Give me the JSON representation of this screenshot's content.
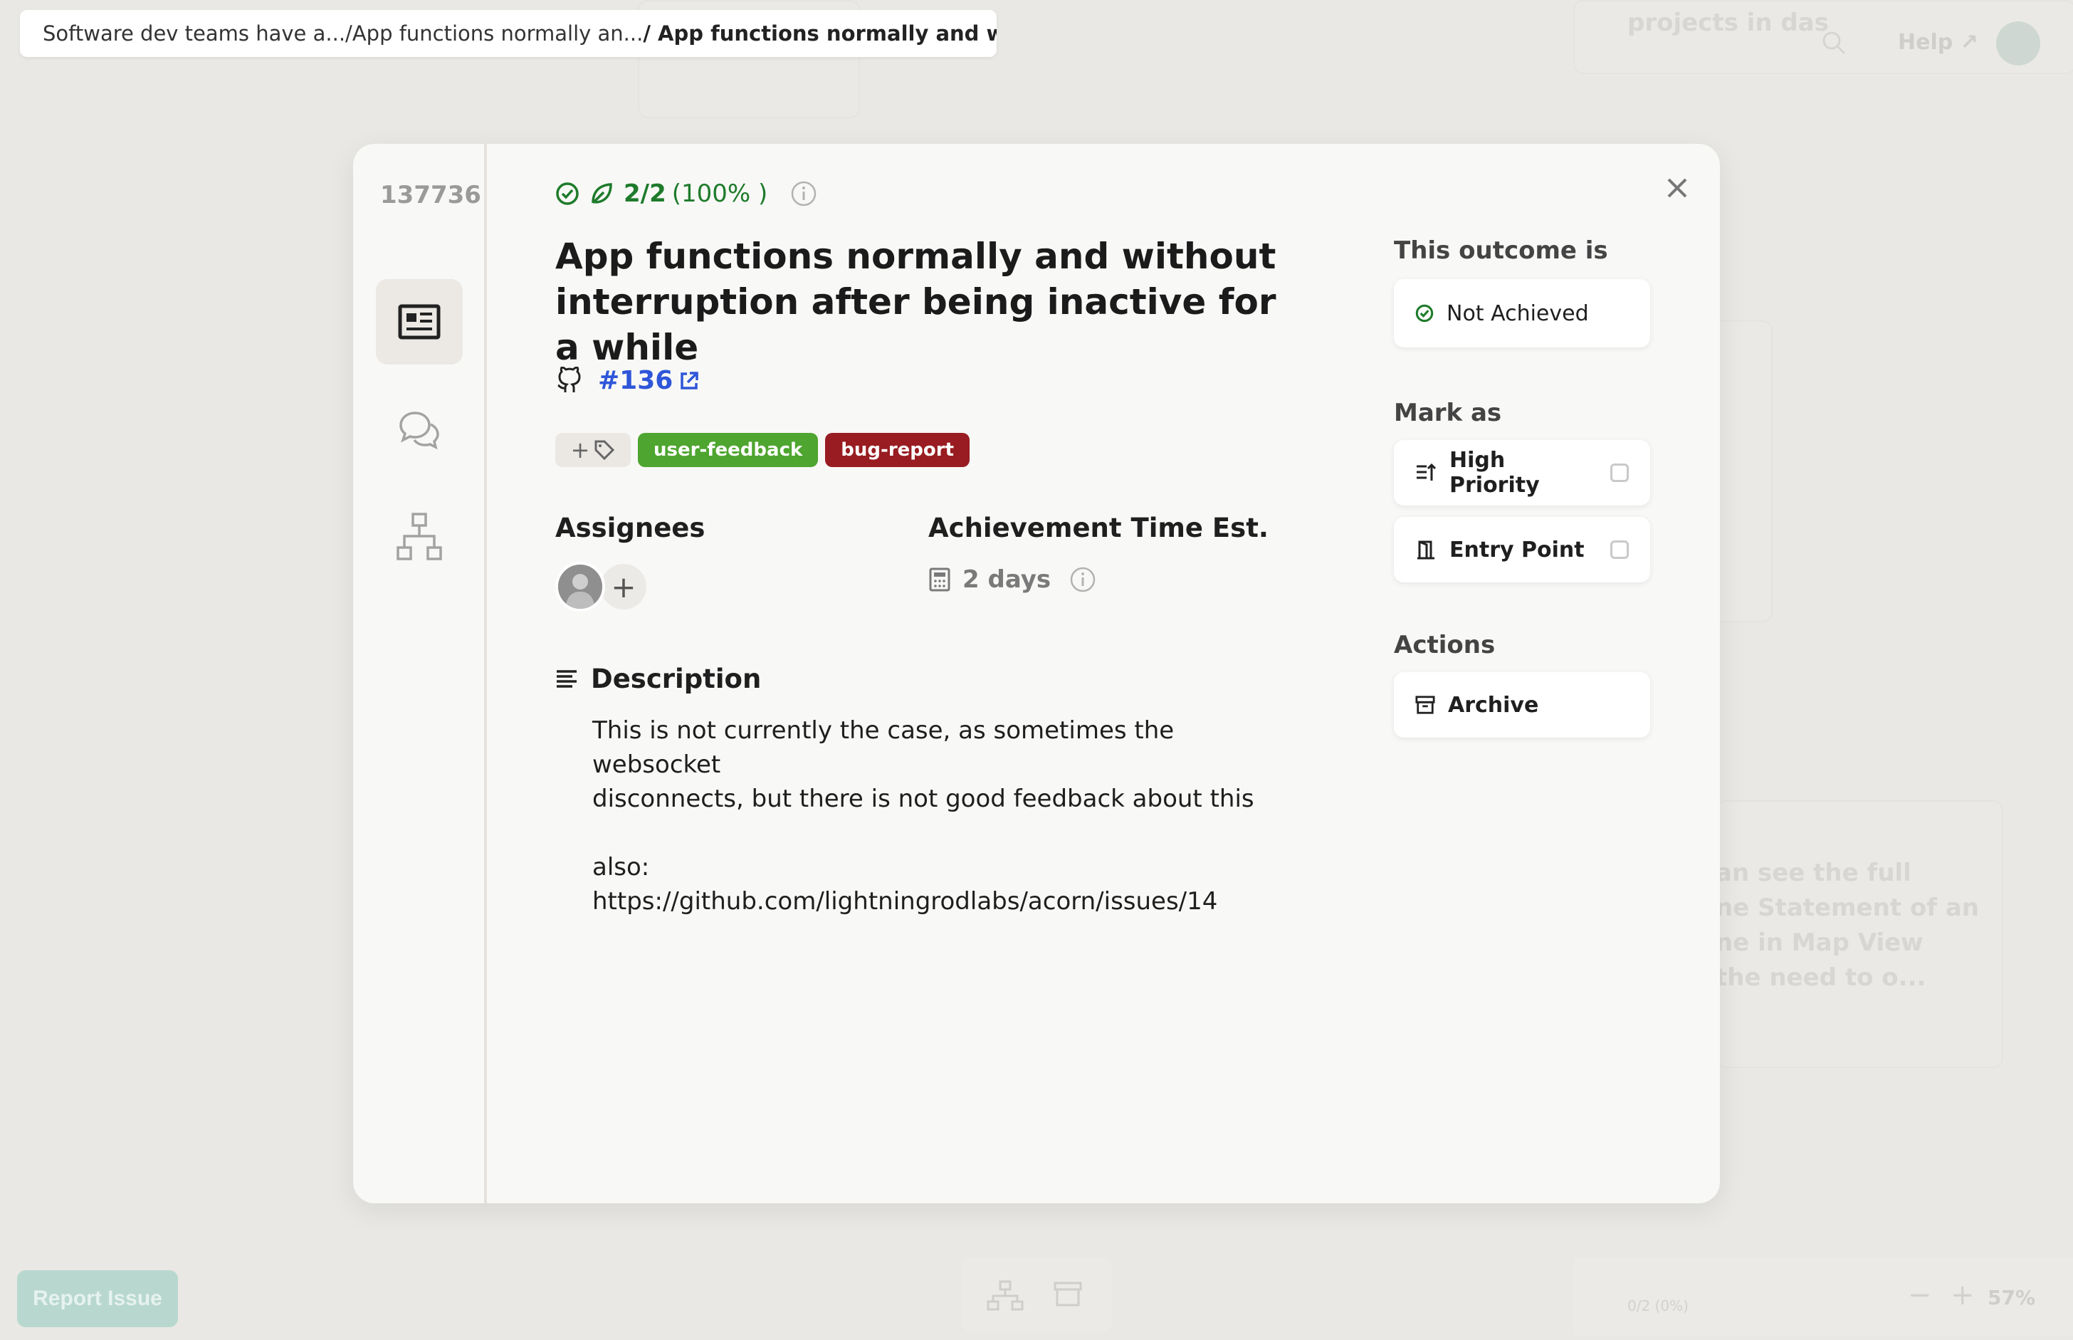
{
  "breadcrumb": {
    "items": [
      "Software dev teams have a...",
      "/App functions normally an...",
      "/ App functions normally and without ..."
    ]
  },
  "background": {
    "help_label": "Help",
    "ghost_title": "projects in das",
    "ghost_card_text": "an see the full\nne Statement of an\nne in Map View\n the need to o...",
    "report_issue_label": "Report Issue",
    "zoom_level": "57%",
    "mini_progress": "0/2 (0%)"
  },
  "modal": {
    "outcome_id": "137736",
    "progress": {
      "count": "2/2",
      "percent": "(100% )"
    },
    "title": "App functions normally and without interruption after being inactive for a while",
    "github": {
      "issue_label": "#136"
    },
    "tags": [
      {
        "label": "user-feedback",
        "color": "#4ea52f"
      },
      {
        "label": "bug-report",
        "color": "#981c21"
      }
    ],
    "assignees_heading": "Assignees",
    "time_heading": "Achievement Time Est.",
    "time_value": "2 days",
    "description_heading": "Description",
    "description_text": "This is not currently the case, as sometimes the websocket\ndisconnects, but there is not good feedback about this\n\nalso:\nhttps://github.com/lightningrodlabs/acorn/issues/14",
    "status_heading": "This outcome is",
    "status_value": "Not Achieved",
    "mark_as_heading": "Mark as",
    "mark_options": [
      {
        "label": "High Priority",
        "checked": false,
        "icon": "high-priority-icon"
      },
      {
        "label": "Entry Point",
        "checked": false,
        "icon": "entry-point-icon"
      }
    ],
    "actions_heading": "Actions",
    "archive_label": "Archive"
  },
  "colors": {
    "achieved_green": "#1e7b2b",
    "link_blue": "#2f56d9"
  }
}
